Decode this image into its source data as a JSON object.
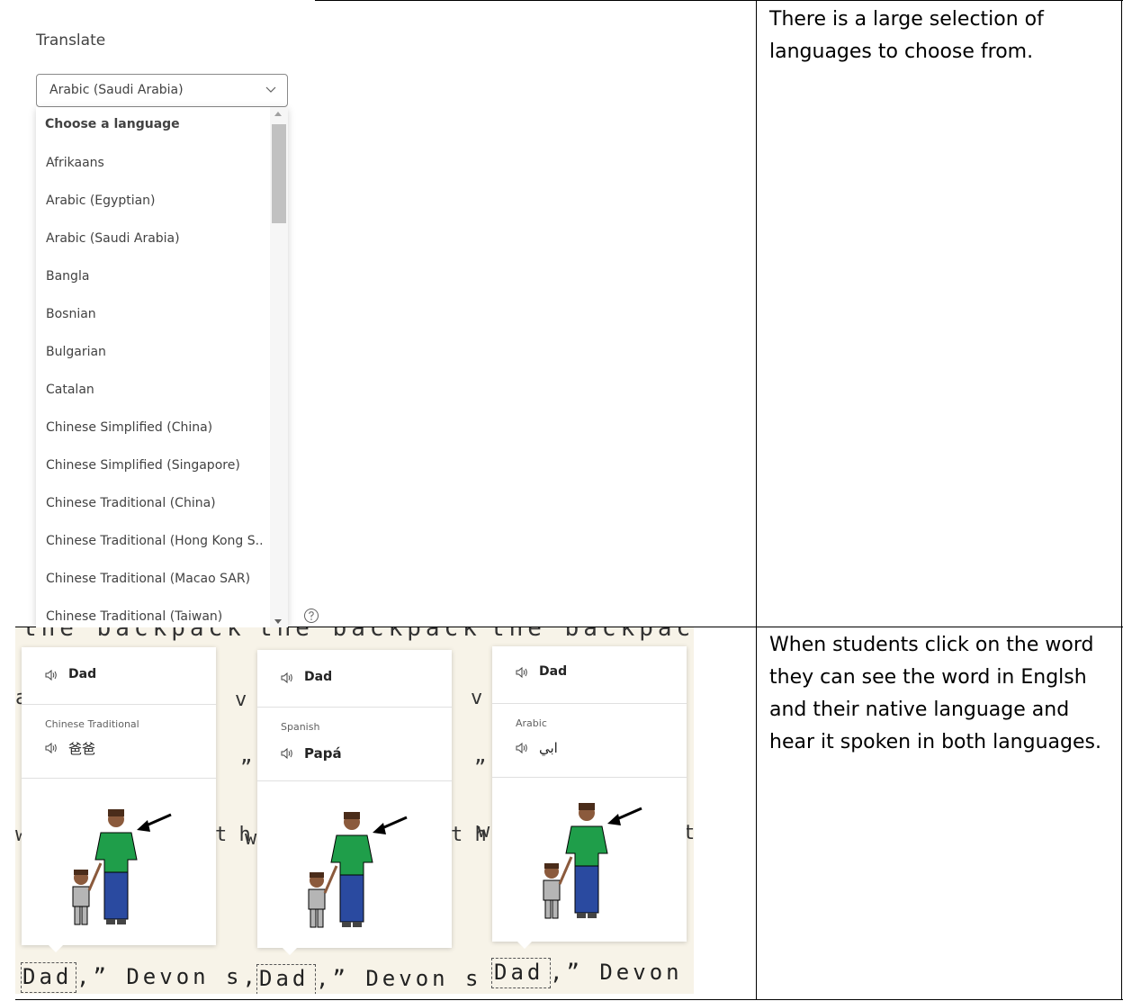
{
  "translate_panel": {
    "title": "Translate",
    "selected_language": "Arabic (Saudi Arabia)",
    "dropdown_header": "Choose a language",
    "options": [
      "Afrikaans",
      "Arabic (Egyptian)",
      "Arabic (Saudi Arabia)",
      "Bangla",
      "Bosnian",
      "Bulgarian",
      "Catalan",
      "Chinese Simplified (China)",
      "Chinese Simplified (Singapore)",
      "Chinese Traditional (China)",
      "Chinese Traditional (Hong Kong S..",
      "Chinese Traditional (Macao SAR)",
      "Chinese Traditional (Taiwan)"
    ]
  },
  "captions": {
    "top": "There is a large selection of languages to choose from.",
    "bottom": "When students click on the word they can see the word in Englsh and their native language and hear it spoken in both languages."
  },
  "reader": {
    "top_text": "the backpack",
    "bottom_words": [
      {
        "word": "Dad",
        "after": ",” Devon s,"
      },
      {
        "word": "Dad",
        "after": ",” Devon s"
      },
      {
        "word": "Dad",
        "after": ",” Devon"
      }
    ],
    "cards": [
      {
        "word": "Dad",
        "language": "Chinese Traditional",
        "translation": "爸爸"
      },
      {
        "word": "Dad",
        "language": "Spanish",
        "translation": "Papá"
      },
      {
        "word": "Dad",
        "language": "Arabic",
        "translation": "ابي"
      }
    ],
    "stray": {
      "a": "a",
      "va1": "v a",
      "va2": "v a",
      "quote": "”",
      "th1": "t h",
      "w": "w",
      "th2": "t h",
      "w2": "w",
      "t": "t"
    }
  },
  "icons": {
    "chevron": "chevron-down-icon",
    "help": "help-icon",
    "speaker": "speaker-icon"
  }
}
